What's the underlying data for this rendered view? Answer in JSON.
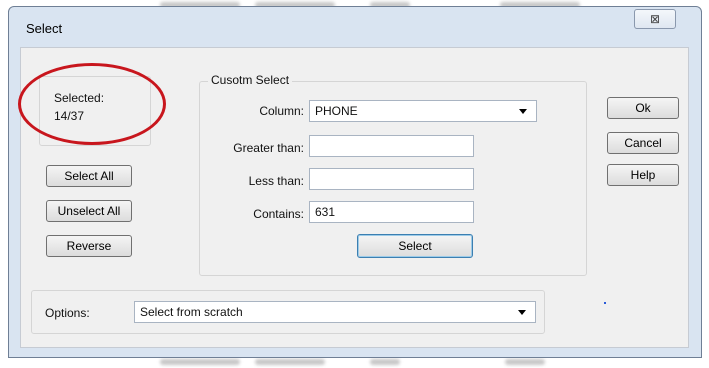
{
  "dialog": {
    "title": "Select",
    "close_symbol": "⊠"
  },
  "selection_status": {
    "label": "Selected:",
    "value": "14/37"
  },
  "left_buttons": {
    "select_all": "Select All",
    "unselect_all": "Unselect All",
    "reverse": "Reverse"
  },
  "custom_select": {
    "legend": "Cusotm Select",
    "column_label": "Column:",
    "column_value": "PHONE",
    "greater_than_label": "Greater than:",
    "greater_than_value": "",
    "less_than_label": "Less than:",
    "less_than_value": "",
    "contains_label": "Contains:",
    "contains_value": "631",
    "select_button": "Select"
  },
  "right_buttons": {
    "ok": "Ok",
    "cancel": "Cancel",
    "help": "Help"
  },
  "options": {
    "label": "Options:",
    "selected_value": "Select from scratch"
  },
  "colors": {
    "annotation_ellipse": "#c8161d",
    "dialog_frame": "#d9e4f1",
    "client_area": "#f0f0f0"
  }
}
